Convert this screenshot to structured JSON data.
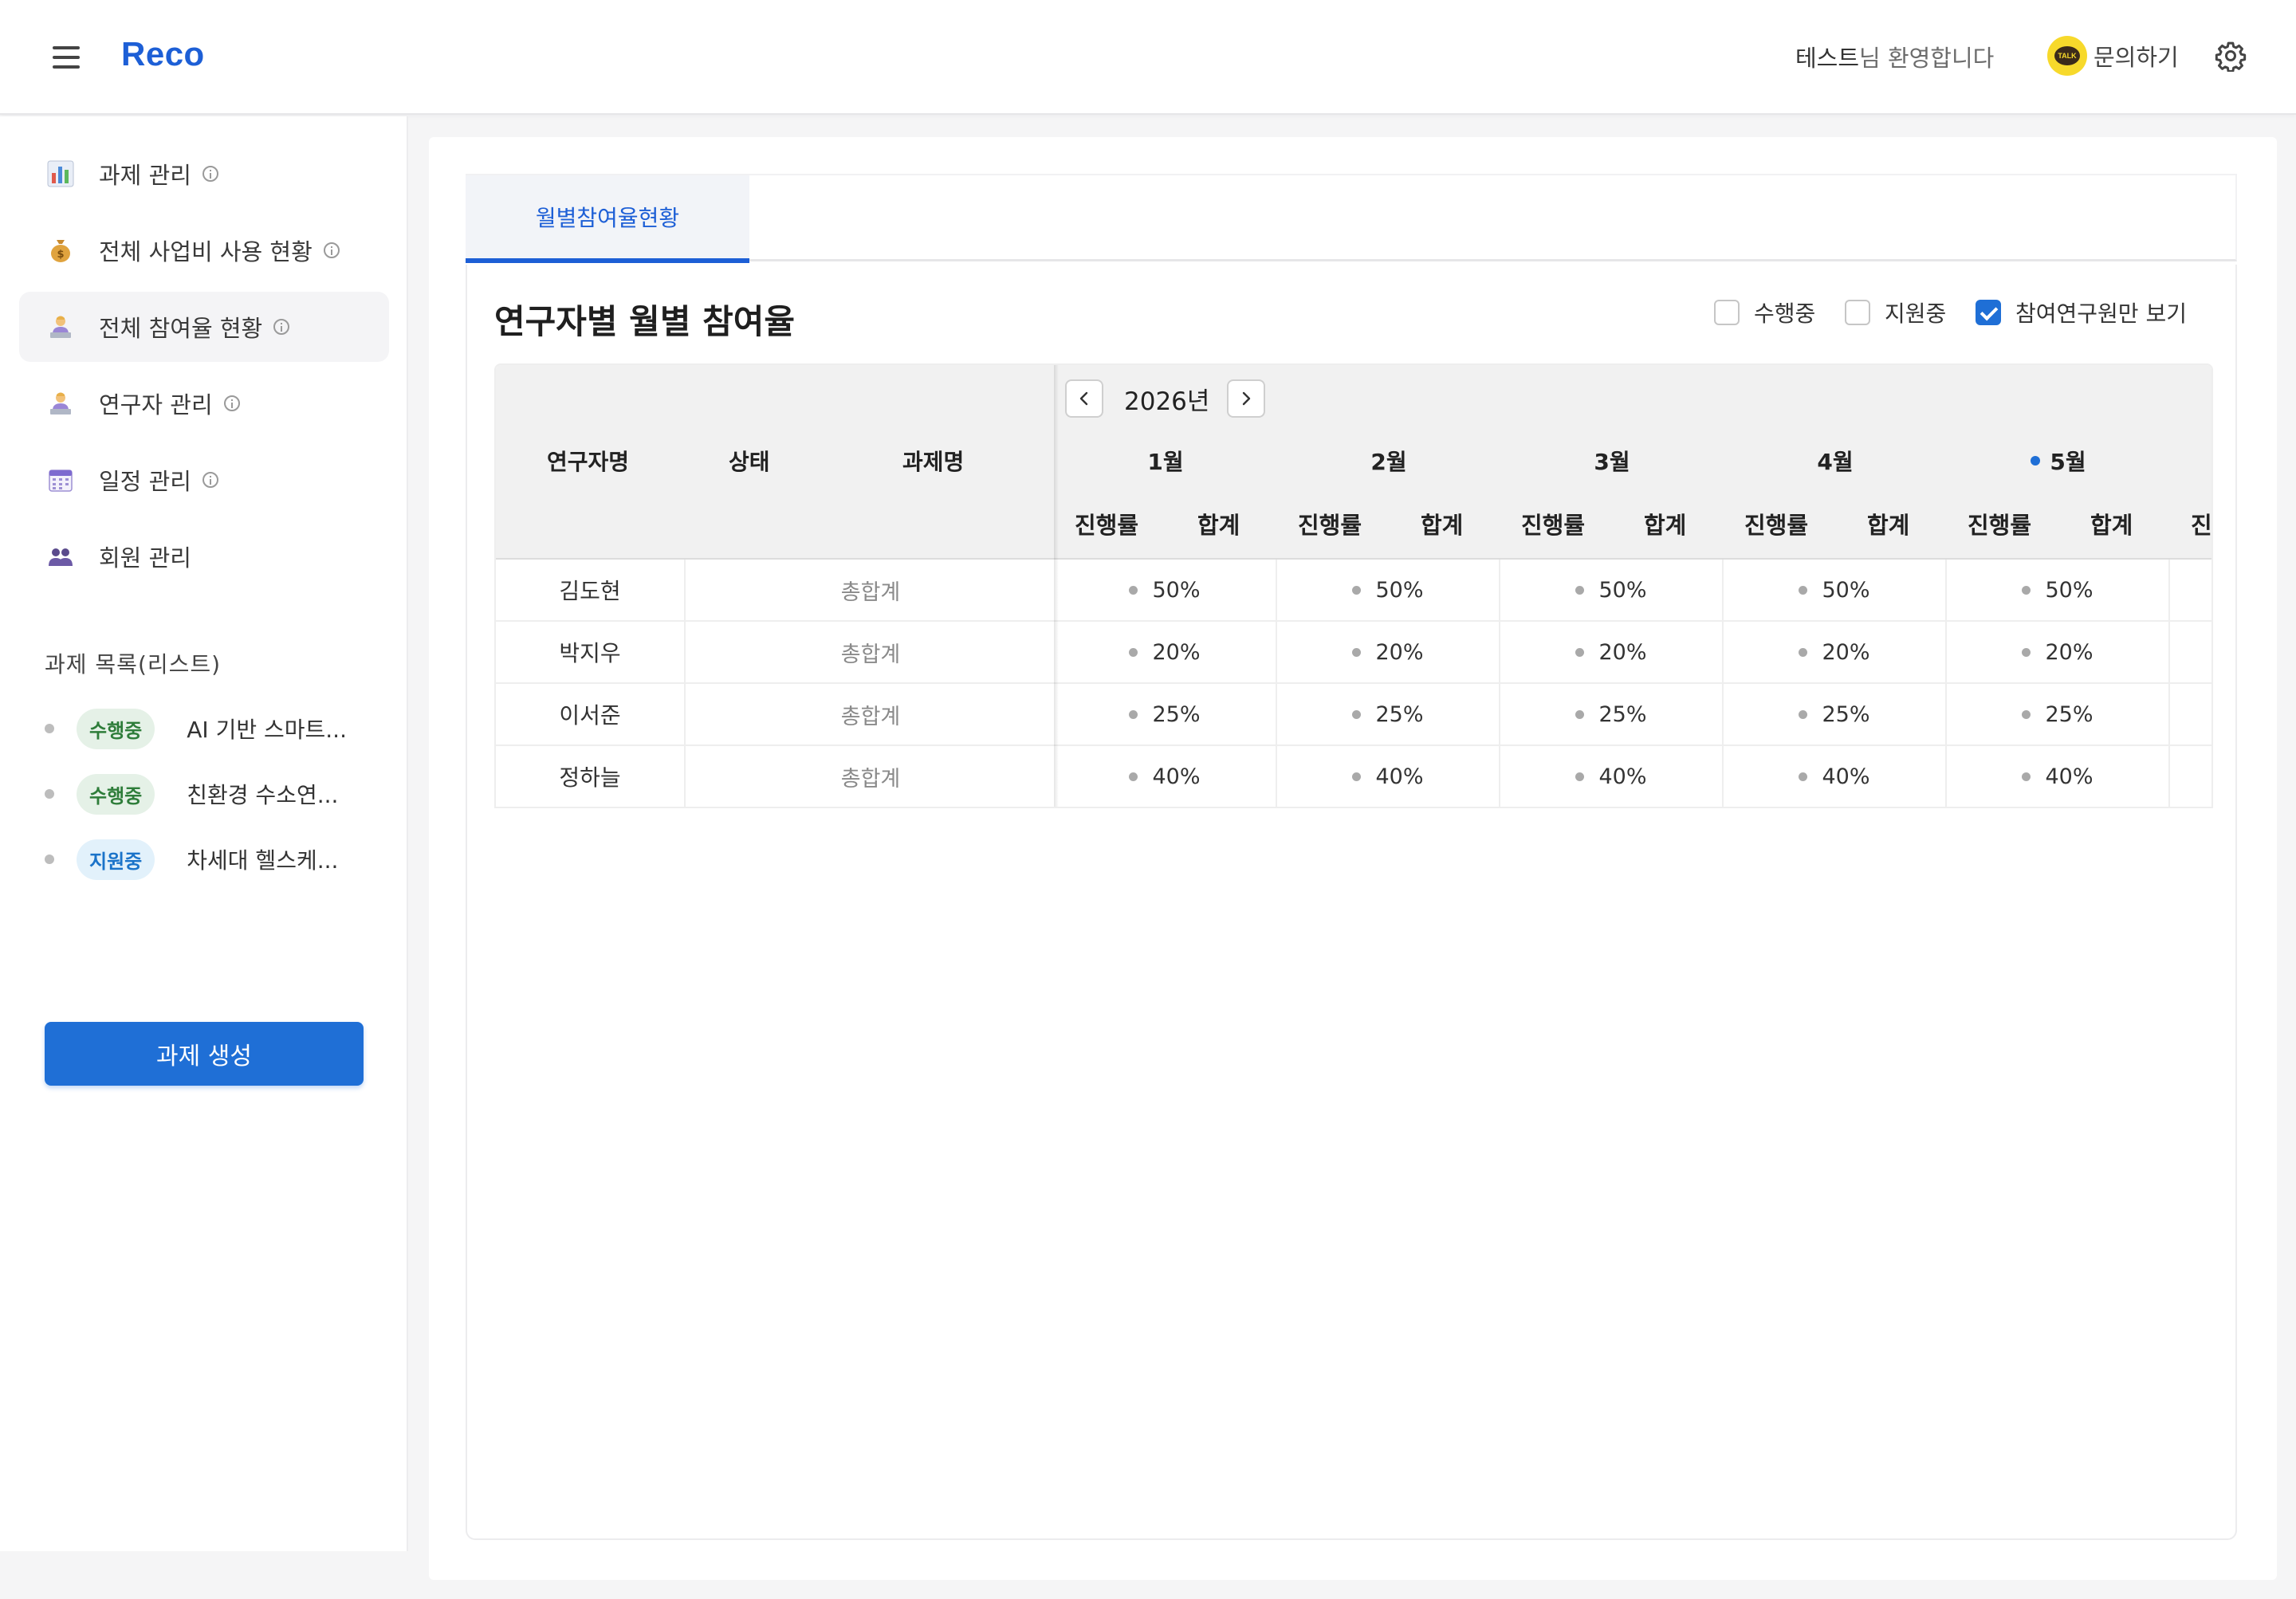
{
  "header": {
    "logo": "Reco",
    "welcome_name": "테스트",
    "welcome_suffix": "님 환영합니다",
    "contact_label": "문의하기",
    "kakao_text": "TALK"
  },
  "sidebar": {
    "items": [
      {
        "label": "과제 관리",
        "icon": "bar-chart-icon"
      },
      {
        "label": "전체 사업비 사용 현황",
        "icon": "money-bag-icon"
      },
      {
        "label": "전체 참여율 현황",
        "icon": "person-at-desk-icon"
      },
      {
        "label": "연구자 관리",
        "icon": "person-at-desk-icon"
      },
      {
        "label": "일정 관리",
        "icon": "calendar-icon"
      },
      {
        "label": "회원 관리",
        "icon": "people-icon"
      }
    ],
    "active_index": 2,
    "section_title": "과제 목록(리스트)",
    "projects": [
      {
        "status": "수행중",
        "name": "AI 기반 스마트...",
        "badge_bg": "#e5f1e7",
        "badge_fg": "#2e7d3a"
      },
      {
        "status": "수행중",
        "name": "친환경 수소연...",
        "badge_bg": "#e5f1e7",
        "badge_fg": "#2e7d3a"
      },
      {
        "status": "지원중",
        "name": "차세대 헬스케...",
        "badge_bg": "#e2f1fb",
        "badge_fg": "#1a73c9"
      }
    ],
    "create_button": "과제 생성"
  },
  "main": {
    "tab_label": "월별참여율현황",
    "title": "연구자별 월별 참여율",
    "filters": [
      {
        "label": "수행중",
        "checked": false
      },
      {
        "label": "지원중",
        "checked": false
      },
      {
        "label": "참여연구원만 보기",
        "checked": true
      }
    ],
    "table": {
      "columns": [
        "연구자명",
        "상태",
        "과제명"
      ],
      "year": "2026년",
      "months": [
        "1월",
        "2월",
        "3월",
        "4월",
        "5월"
      ],
      "current_month_index": 4,
      "sub_columns": [
        "진행률",
        "합계"
      ],
      "partial_sub_column": "진",
      "total_label": "총합계",
      "rows": [
        {
          "name": "김도현",
          "values": [
            "50%",
            "50%",
            "50%",
            "50%",
            "50%"
          ]
        },
        {
          "name": "박지우",
          "values": [
            "20%",
            "20%",
            "20%",
            "20%",
            "20%"
          ]
        },
        {
          "name": "이서준",
          "values": [
            "25%",
            "25%",
            "25%",
            "25%",
            "25%"
          ]
        },
        {
          "name": "정하늘",
          "values": [
            "40%",
            "40%",
            "40%",
            "40%",
            "40%"
          ]
        }
      ]
    }
  },
  "colors": {
    "accent": "#1d5fd6",
    "button": "#1f6fd6",
    "kakao": "#f7d92b"
  }
}
